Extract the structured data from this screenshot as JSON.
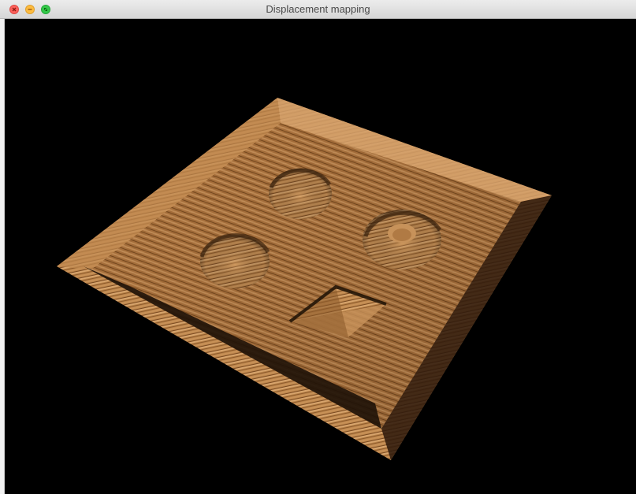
{
  "window": {
    "title": "Displacement mapping"
  },
  "controls": {
    "close_icon": "close-icon",
    "minimize_icon": "minimize-icon",
    "zoom_icon": "zoom-icon"
  },
  "scene": {
    "material": "wood",
    "background_color": "#000000",
    "wood_light": "#c9985f",
    "wood_dark": "#7a4e24",
    "shadow_color": "#2e1c0c"
  }
}
